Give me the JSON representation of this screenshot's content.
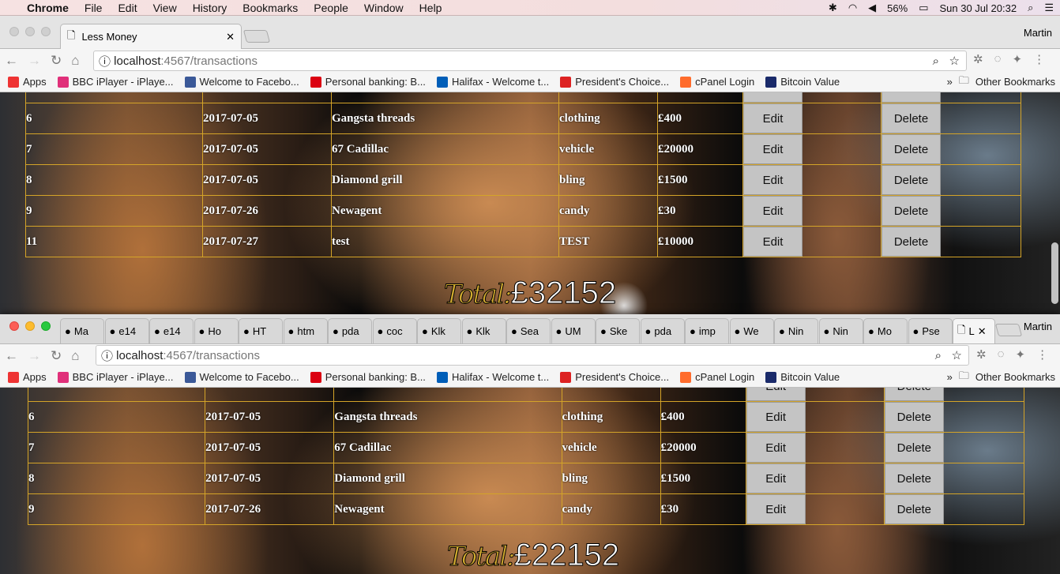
{
  "menubar": {
    "app": "Chrome",
    "items": [
      "File",
      "Edit",
      "View",
      "History",
      "Bookmarks",
      "People",
      "Window",
      "Help"
    ],
    "battery": "56%",
    "datetime": "Sun 30 Jul  20:32"
  },
  "browser": {
    "profile": "Martin",
    "url_host": "localhost",
    "url_path": ":4567/transactions",
    "bookmarks": [
      {
        "label": "Apps",
        "color": "#e33"
      },
      {
        "label": "BBC iPlayer - iPlaye...",
        "color": "#e0307a"
      },
      {
        "label": "Welcome to Facebo...",
        "color": "#3b5998"
      },
      {
        "label": "Personal banking: B...",
        "color": "#db0011"
      },
      {
        "label": "Halifax - Welcome t...",
        "color": "#005eb8"
      },
      {
        "label": "President's Choice...",
        "color": "#d22"
      },
      {
        "label": "cPanel Login",
        "color": "#ff6c2c"
      },
      {
        "label": "Bitcoin Value",
        "color": "#1a2a6a"
      }
    ],
    "other_bookmarks": "Other Bookmarks"
  },
  "window1": {
    "tab_title": "Less Money",
    "total_label": "Total:",
    "total_amount": "£32152",
    "rows": [
      {
        "id": "6",
        "date": "2017-07-05",
        "name": "Gangsta threads",
        "category": "clothing",
        "amount": "£400"
      },
      {
        "id": "7",
        "date": "2017-07-05",
        "name": "67 Cadillac",
        "category": "vehicle",
        "amount": "£20000"
      },
      {
        "id": "8",
        "date": "2017-07-05",
        "name": "Diamond grill",
        "category": "bling",
        "amount": "£1500"
      },
      {
        "id": "9",
        "date": "2017-07-26",
        "name": "Newagent",
        "category": "candy",
        "amount": "£30"
      },
      {
        "id": "11",
        "date": "2017-07-27",
        "name": "test",
        "category": "TEST",
        "amount": "£10000"
      }
    ]
  },
  "window2": {
    "tabs": [
      "Ma",
      "e14",
      "e14",
      "Ho",
      "HT",
      "htm",
      "pda",
      "coc",
      "Klk",
      "Klk",
      "Sea",
      "UM",
      "Ske",
      "pda",
      "imp",
      "We",
      "Nin",
      "Nin",
      "Mo",
      "Pse",
      "L"
    ],
    "total_label": "Total:",
    "total_amount": "£22152",
    "rows": [
      {
        "id": "6",
        "date": "2017-07-05",
        "name": "Gangsta threads",
        "category": "clothing",
        "amount": "£400"
      },
      {
        "id": "7",
        "date": "2017-07-05",
        "name": "67 Cadillac",
        "category": "vehicle",
        "amount": "£20000"
      },
      {
        "id": "8",
        "date": "2017-07-05",
        "name": "Diamond grill",
        "category": "bling",
        "amount": "£1500"
      },
      {
        "id": "9",
        "date": "2017-07-26",
        "name": "Newagent",
        "category": "candy",
        "amount": "£30"
      }
    ]
  },
  "buttons": {
    "edit": "Edit",
    "delete": "Delete"
  }
}
